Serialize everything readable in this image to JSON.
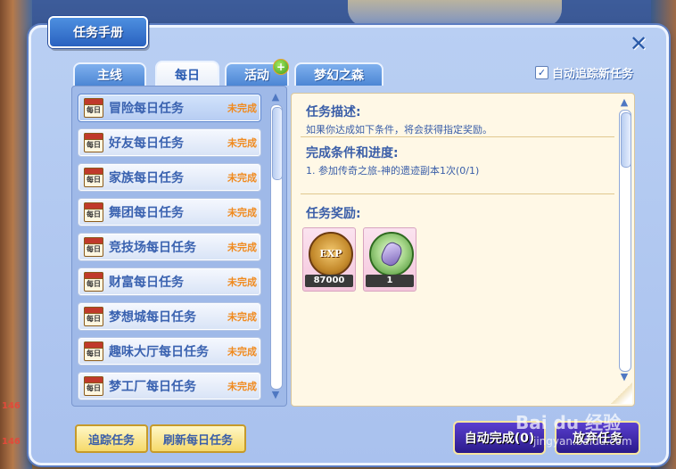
{
  "window": {
    "title": "任务手册",
    "close_icon": "close-icon"
  },
  "tabs": [
    {
      "label": "主线",
      "active": false
    },
    {
      "label": "每日",
      "active": true
    },
    {
      "label": "活动",
      "active": false,
      "badge_icon": "new-plus-icon"
    },
    {
      "label": "梦幻之森",
      "active": false
    }
  ],
  "auto_track": {
    "label": "自动追踪新任务",
    "checked": true
  },
  "task_list": [
    {
      "name": "冒险每日任务",
      "status": "未完成",
      "selected": true
    },
    {
      "name": "好友每日任务",
      "status": "未完成"
    },
    {
      "name": "家族每日任务",
      "status": "未完成"
    },
    {
      "name": "舞团每日任务",
      "status": "未完成"
    },
    {
      "name": "竞技场每日任务",
      "status": "未完成"
    },
    {
      "name": "财富每日任务",
      "status": "未完成"
    },
    {
      "name": "梦想城每日任务",
      "status": "未完成"
    },
    {
      "name": "趣味大厅每日任务",
      "status": "未完成"
    },
    {
      "name": "梦工厂每日任务",
      "status": "未完成"
    }
  ],
  "task_icon_text": "每日",
  "detail": {
    "desc_title": "任务描述:",
    "desc_text": "如果你达成如下条件，将会获得指定奖励。",
    "progress_title": "完成条件和进度:",
    "progress_text": "1. 参加传奇之旅-神的遗迹副本1次(0/1)",
    "reward_title": "任务奖励:",
    "rewards": [
      {
        "icon": "exp-icon",
        "icon_text": "EXP",
        "count": "87000"
      },
      {
        "icon": "gem-icon",
        "count": "1"
      }
    ]
  },
  "buttons": {
    "track": "追踪任务",
    "refresh": "刷新每日任务",
    "auto_complete": "自动完成(0)",
    "abandon": "放弃任务"
  },
  "watermark": {
    "main": "Bai du 经验",
    "sub": "jingyan.baidu.com"
  },
  "background": {
    "hp_1": "146",
    "hp_2": "146"
  }
}
